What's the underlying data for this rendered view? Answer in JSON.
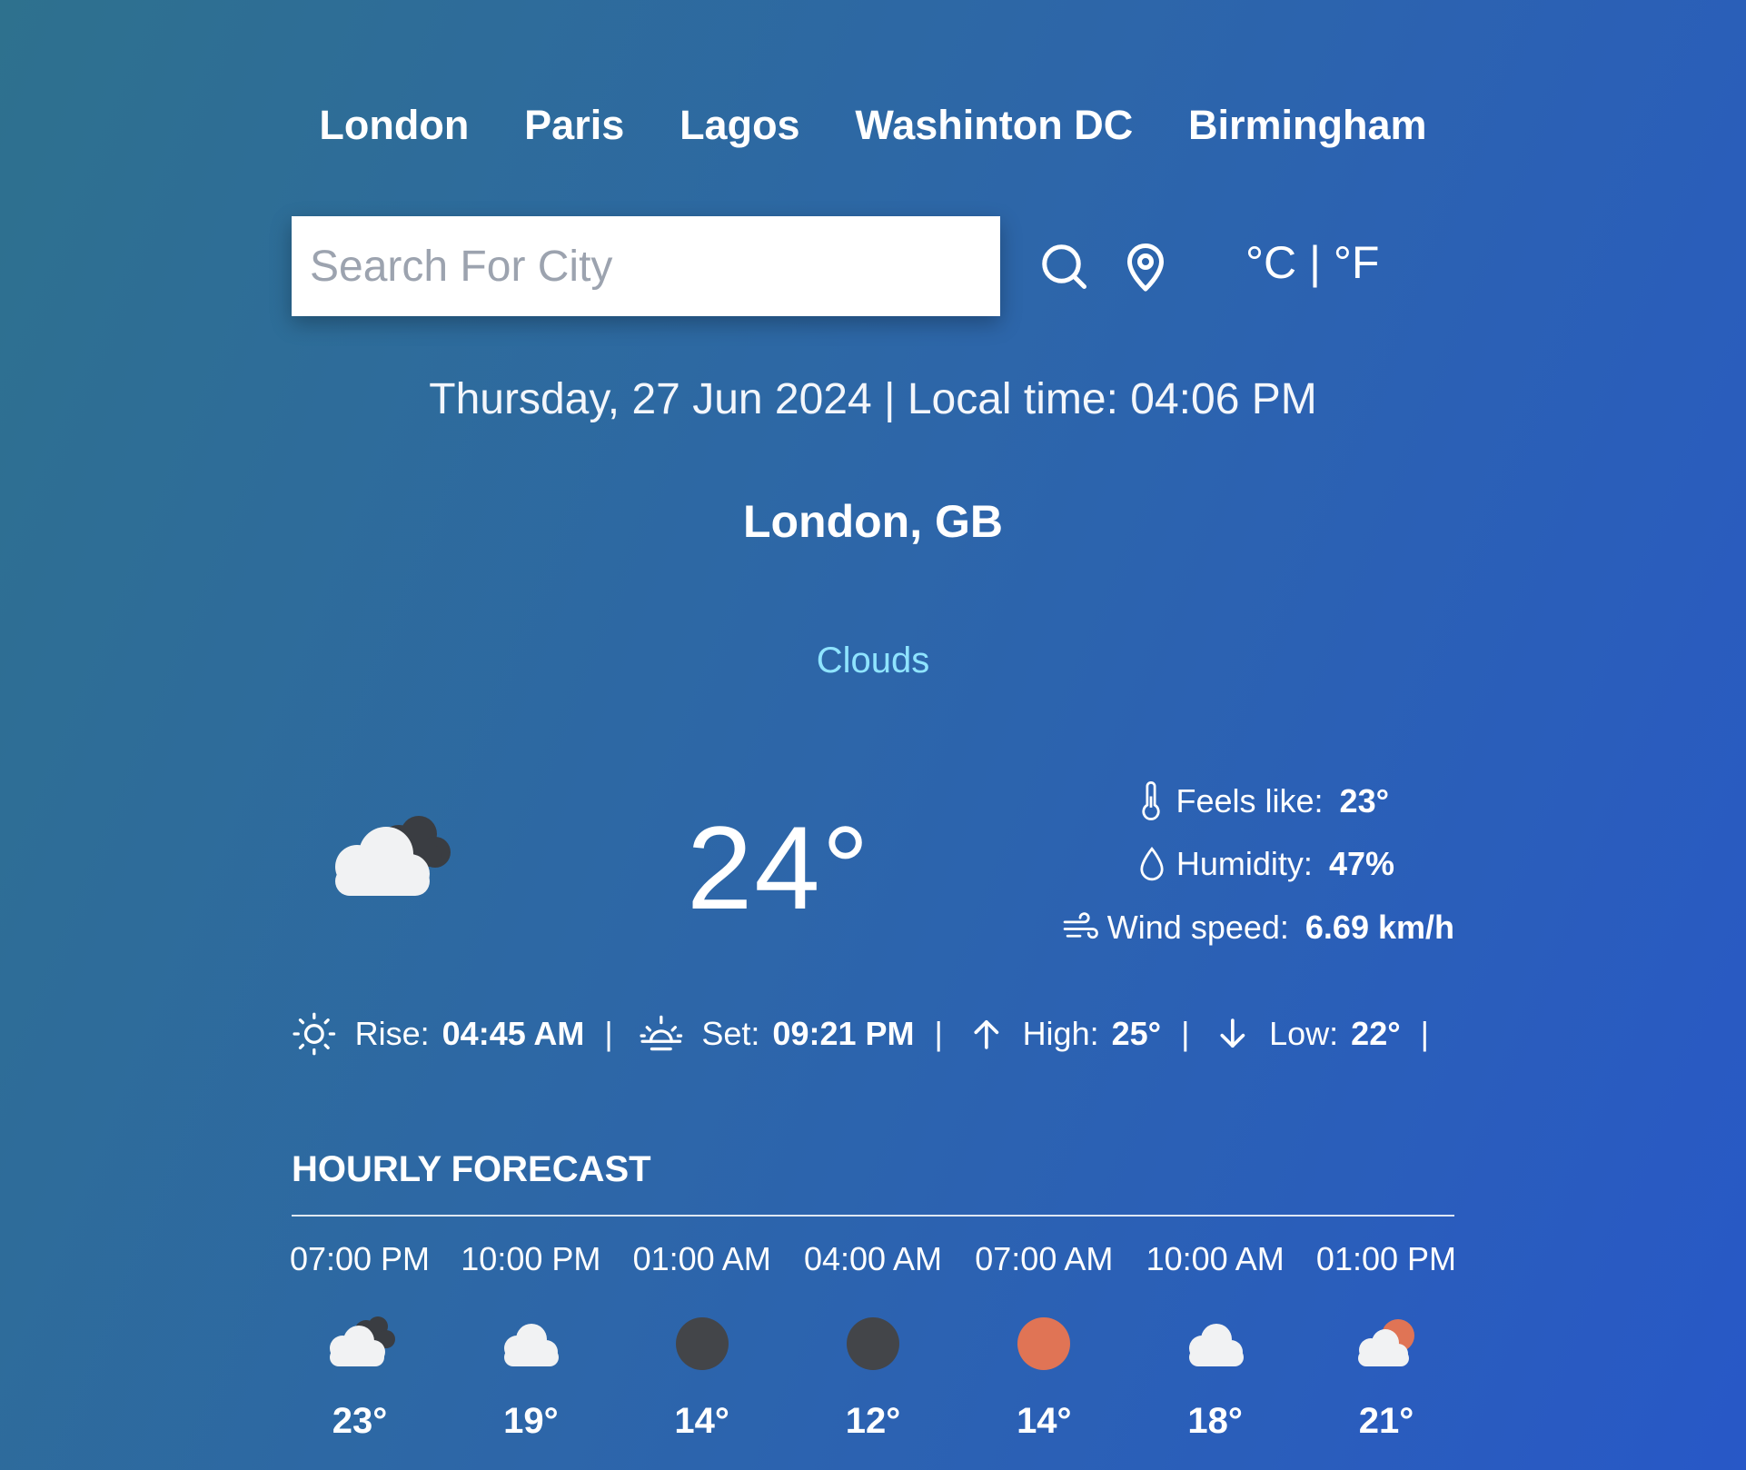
{
  "cities": [
    "London",
    "Paris",
    "Lagos",
    "Washinton DC",
    "Birmingham"
  ],
  "search": {
    "placeholder": "Search For City"
  },
  "icons": {
    "search": "search-icon",
    "location": "location-pin-icon"
  },
  "units": {
    "celsius": "°C",
    "separator": "|",
    "fahrenheit": "°F"
  },
  "datetime": "Thursday, 27 Jun 2024 | Local time: 04:06 PM",
  "location": "London, GB",
  "condition": "Clouds",
  "current": {
    "icon": "cloud-icon",
    "temperature": "24°",
    "feels_like_label": "Feels like:",
    "feels_like": "23°",
    "humidity_label": "Humidity:",
    "humidity": "47%",
    "wind_label": "Wind speed:",
    "wind": "6.69 km/h"
  },
  "sun": {
    "rise_label": "Rise:",
    "rise": "04:45 AM",
    "set_label": "Set:",
    "set": "09:21 PM",
    "high_label": "High:",
    "high": "25°",
    "low_label": "Low:",
    "low": "22°",
    "separator": "|"
  },
  "hourly": {
    "title": "HOURLY FORECAST",
    "items": [
      {
        "time": "07:00 PM",
        "temp": "23°",
        "icon": "cloud-dark-icon"
      },
      {
        "time": "10:00 PM",
        "temp": "19°",
        "icon": "cloud-icon"
      },
      {
        "time": "01:00 AM",
        "temp": "14°",
        "icon": "moon-icon"
      },
      {
        "time": "04:00 AM",
        "temp": "12°",
        "icon": "moon-icon"
      },
      {
        "time": "07:00 AM",
        "temp": "14°",
        "icon": "sun-icon"
      },
      {
        "time": "10:00 AM",
        "temp": "18°",
        "icon": "cloud-icon"
      },
      {
        "time": "01:00 PM",
        "temp": "21°",
        "icon": "partly-cloudy-icon"
      }
    ]
  },
  "colors": {
    "background_start": "#2e718e",
    "background_end": "#2858c7",
    "condition": "#8fe4ff",
    "cloud": "#f1f2f3",
    "dark_cloud": "#3a3d42",
    "moon": "#434549",
    "sun": "#e07455"
  }
}
